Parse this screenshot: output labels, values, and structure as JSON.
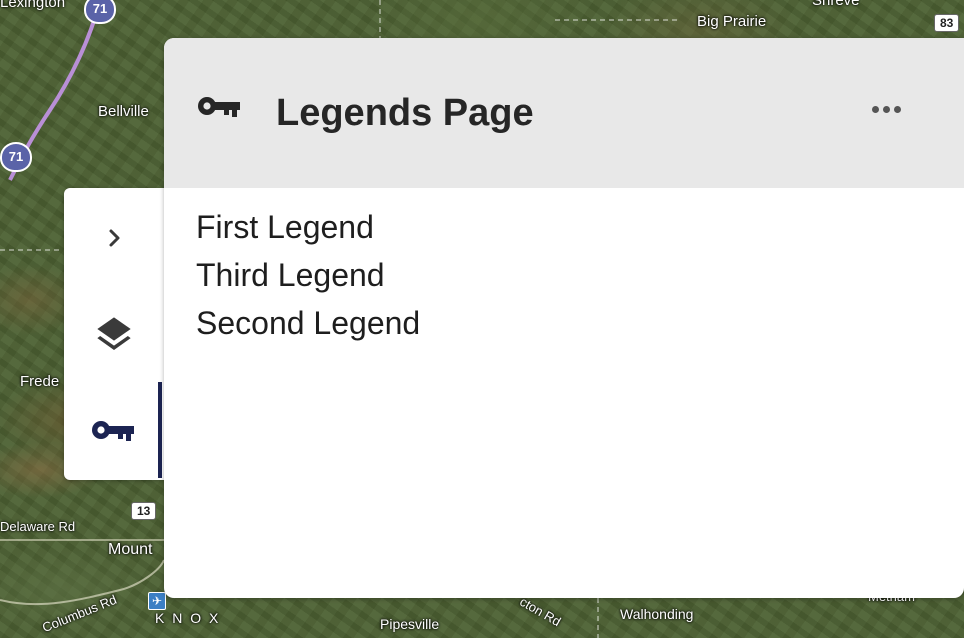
{
  "map": {
    "labels": {
      "lexington": "Lexington",
      "bellville": "Bellville",
      "frede": "Frede",
      "delaware_rd": "Delaware Rd",
      "mount": "Mount",
      "columbus_rd": "Columbus Rd",
      "knox": "K N O X",
      "pipesville": "Pipesville",
      "walhonding": "Walhonding",
      "big_prairie": "Big Prairie",
      "shreve": "Shreve",
      "cton_rd": "cton Rd",
      "metham": "Metham"
    },
    "shields": {
      "i71_top": "71",
      "i71_left": "71",
      "route_83": "83",
      "route_13": "13"
    }
  },
  "rail": {
    "items": [
      {
        "name": "expand",
        "icon": "chevron-right-icon",
        "active": false
      },
      {
        "name": "layers",
        "icon": "layers-icon",
        "active": false
      },
      {
        "name": "legends",
        "icon": "key-icon",
        "active": true
      }
    ]
  },
  "panel": {
    "title": "Legends Page",
    "header_icon": "key-icon",
    "more_icon": "more-horizontal-icon",
    "legends": [
      "First Legend",
      "Third Legend",
      "Second Legend"
    ]
  },
  "colors": {
    "accent": "#1c2452",
    "header_bg": "#e8e8e8",
    "interstate_shield": "#5a63a8"
  }
}
